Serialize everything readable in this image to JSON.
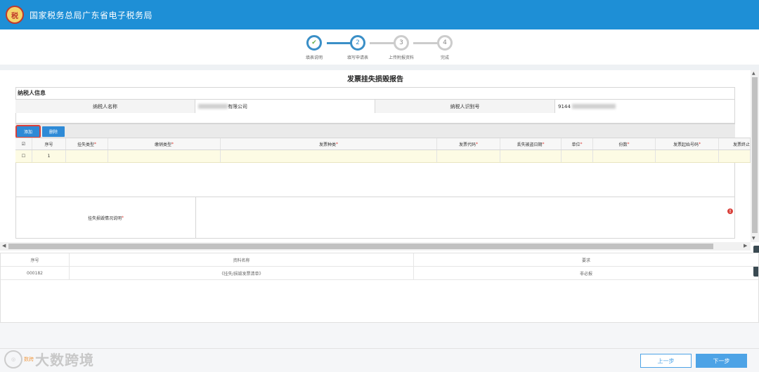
{
  "header": {
    "title": "国家税务总局广东省电子税务局",
    "logo_text": "税"
  },
  "steps": [
    {
      "label": "填表说明",
      "num": "✔",
      "state": "done"
    },
    {
      "label": "填写申请表",
      "num": "2",
      "state": "active"
    },
    {
      "label": "上传附报资料",
      "num": "3",
      "state": "todo"
    },
    {
      "label": "完成",
      "num": "4",
      "state": "todo"
    }
  ],
  "form": {
    "title": "发票挂失损毁报告",
    "section_title": "纳税人信息",
    "taxpayer_name_label": "纳税人名称",
    "taxpayer_name_value": "有限公司",
    "taxpayer_id_label": "纳税人识别号",
    "taxpayer_id_value": "9144"
  },
  "toolbar": {
    "add_label": "添加",
    "delete_label": "删除"
  },
  "grid": {
    "columns": [
      "序号",
      "挂失类型",
      "缴销类型",
      "发票种类",
      "发票代码",
      "丢失被盗日期",
      "单位",
      "份数",
      "发票起始号码",
      "发票终止"
    ],
    "required": [
      false,
      true,
      true,
      true,
      true,
      true,
      true,
      true,
      true,
      false
    ],
    "row": {
      "seq": "1"
    }
  },
  "description": {
    "label": "挂失损毁情况说明",
    "warn_icon": "!"
  },
  "attachments": {
    "headers": [
      "序号",
      "资料名称",
      "要求"
    ],
    "rows": [
      {
        "seq": "000182",
        "name": "《挂失/损毁发票清单》",
        "req": "非必报"
      }
    ]
  },
  "footer": {
    "prev_label": "上一步",
    "next_label": "下一步"
  },
  "watermark": {
    "text": "大数跨境",
    "small": "数跨"
  },
  "colors": {
    "header": "#1e8fd6",
    "primary_button": "#2e8ad6",
    "required": "#d9403a",
    "next_button": "#4da3e6"
  }
}
